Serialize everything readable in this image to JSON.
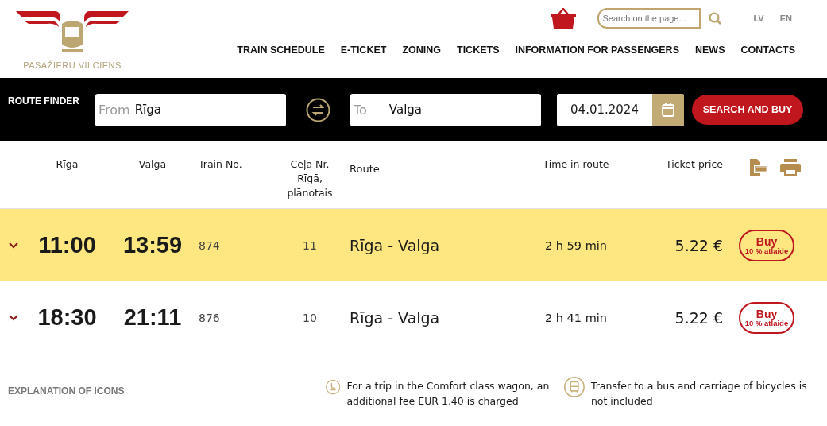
{
  "logo": {
    "text": "PASAŽIERU VILCIENS"
  },
  "search": {
    "placeholder": "Search on the page..."
  },
  "languages": [
    {
      "label": "LV",
      "selected": false
    },
    {
      "label": "EN",
      "selected": false
    }
  ],
  "nav": [
    "TRAIN SCHEDULE",
    "E-TICKET",
    "ZONING",
    "TICKETS",
    "INFORMATION FOR PASSENGERS",
    "NEWS",
    "CONTACTS"
  ],
  "route_finder": {
    "label": "ROUTE FINDER",
    "from_label": "From",
    "from_value": "Rīga",
    "to_label": "To",
    "to_value": "Valga",
    "date": "04.01.2024",
    "button": "SEARCH AND BUY"
  },
  "table": {
    "columns": [
      "Rīga",
      "Valga",
      "Train No.",
      "Ceļa Nr. Rīgā, plānotais",
      "Route",
      "Time in route",
      "Ticket price"
    ],
    "rows": [
      {
        "selected": true,
        "expanded": false,
        "departure": "11:00",
        "arrival": "13:59",
        "train_no": "874",
        "track": "11",
        "route": "Rīga - Valga",
        "duration": "2 h 59 min",
        "price": "5.22 €",
        "buy": "Buy",
        "discount": "10 % atlaide"
      },
      {
        "selected": false,
        "expanded": false,
        "departure": "18:30",
        "arrival": "21:11",
        "train_no": "876",
        "track": "10",
        "route": "Rīga - Valga",
        "duration": "2 h 41 min",
        "price": "5.22 €",
        "buy": "Buy",
        "discount": "10 % atlaide"
      }
    ]
  },
  "explanation": {
    "title": "EXPLANATION OF ICONS",
    "items": [
      {
        "kind": "seat",
        "text": "For a trip in the Comfort class wagon, an additional fee EUR 1.40 is charged"
      },
      {
        "kind": "bus",
        "text": "Transfer to a bus and carriage of bicycles is not included"
      }
    ]
  }
}
